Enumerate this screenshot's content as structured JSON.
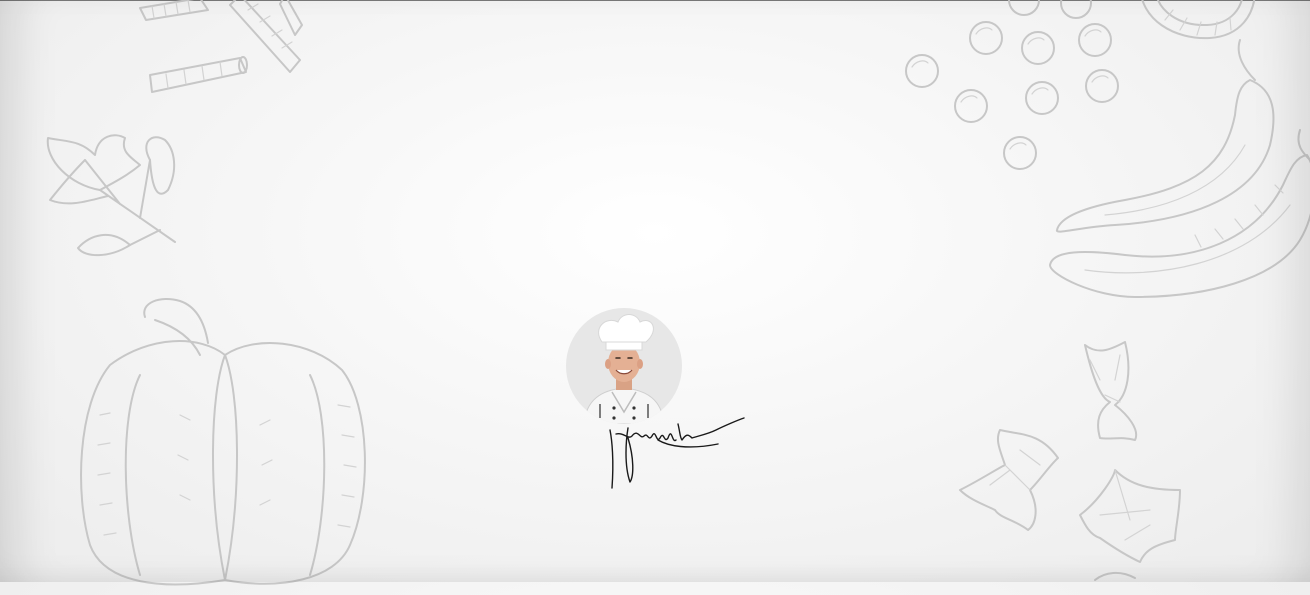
{
  "page": {
    "background_colors": [
      "#ffffff",
      "#ececec"
    ],
    "sketch_color": "#c7c7c7"
  },
  "profile": {
    "avatar": "chef-portrait",
    "signature": "handwritten-signature"
  },
  "decorations": [
    "penne-pasta-sketch",
    "parsley-leaf-sketch",
    "bell-pepper-sketch",
    "peas-sketch",
    "chili-pepper-sketch",
    "farfalle-pasta-sketch"
  ]
}
